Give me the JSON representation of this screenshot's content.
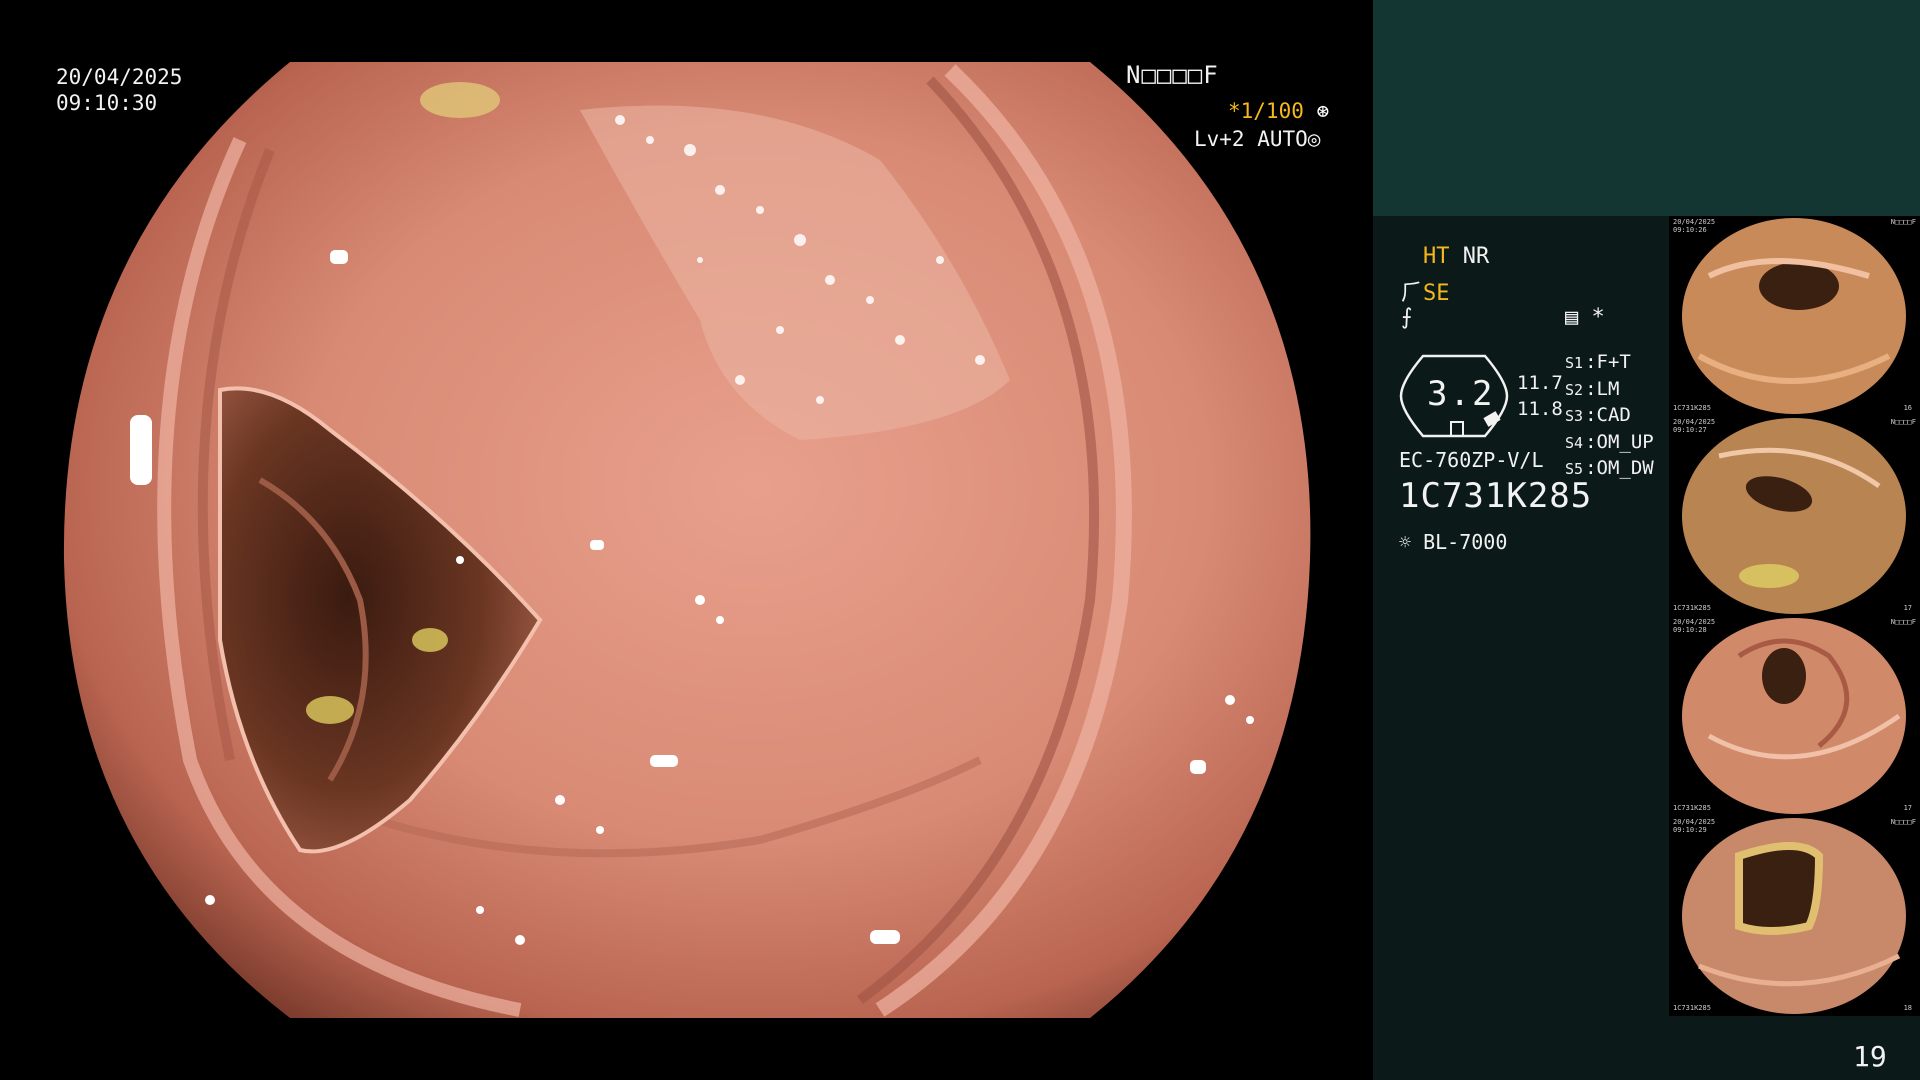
{
  "main_view": {
    "date": "20/04/2025",
    "time": "09:10:30",
    "patient_id": "N□□□□F",
    "shutter_prefix": "*1/100",
    "shutter_icon": "aperture-icon",
    "iris_mode": "Lv+2 AUTO",
    "iris_icon": "iris-icon"
  },
  "panel": {
    "ht_label": "HT",
    "nr_label": "NR",
    "se_label": "SE",
    "structure_icon": "structure-enhance-icon",
    "color_icon": "color-enhance-icon",
    "memo_icon": "memo-icon",
    "asterisk": "*",
    "gauge_value": "3.2",
    "level_1": "11.7",
    "level_2": "11.8",
    "scope_settings": [
      {
        "key": "S1",
        "value": "F+T"
      },
      {
        "key": "S2",
        "value": "LM"
      },
      {
        "key": "S3",
        "value": "CAD"
      },
      {
        "key": "S4",
        "value": "OM_UP"
      },
      {
        "key": "S5",
        "value": "OM_DW"
      }
    ],
    "scope_model": "EC-760ZP-V/L",
    "scope_serial": "1C731K285",
    "light_source": "BL-7000",
    "light_icon": "light-source-icon",
    "page_number": "19"
  },
  "thumbnails": [
    {
      "date": "20/04/2025",
      "time": "09:10:26",
      "id": "N□□□□F",
      "serial": "1C731K285",
      "number": "16"
    },
    {
      "date": "20/04/2025",
      "time": "09:10:27",
      "id": "N□□□□F",
      "serial": "1C731K285",
      "number": "17"
    },
    {
      "date": "20/04/2025",
      "time": "09:10:28",
      "id": "N□□□□F",
      "serial": "1C731K285",
      "number": "17"
    },
    {
      "date": "20/04/2025",
      "time": "09:10:29",
      "id": "N□□□□F",
      "serial": "1C731K285",
      "number": "18"
    }
  ],
  "colors": {
    "mucosa": "#d98a78",
    "lumen": "#4a2418",
    "panel_bg": "#0b1a18",
    "panel_top": "#143632",
    "accent": "#f5b81c"
  }
}
